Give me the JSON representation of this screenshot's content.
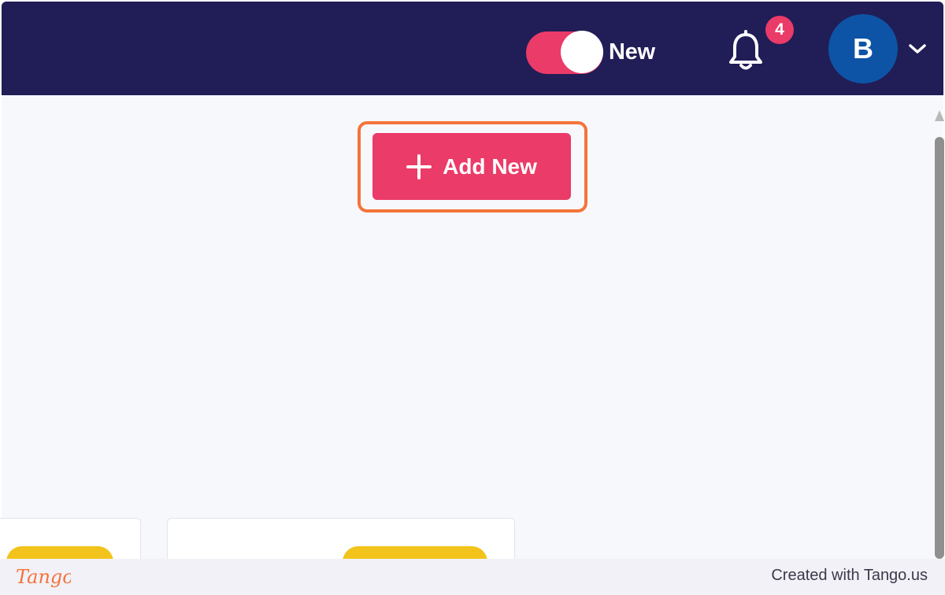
{
  "colors": {
    "navbar": "#211d57",
    "accent": "#eb3b68",
    "toggle_track": "#eb3b68",
    "highlight": "#f4743b",
    "avatar": "#0d54a6",
    "pill": "#f2c31a",
    "footer_text": "#3a3a4a",
    "logo": "#f4743b"
  },
  "header": {
    "toggle_label": "New",
    "toggle_on": true,
    "notification_icon": "bell-icon",
    "notification_count": "4",
    "avatar_initial": "B",
    "menu_icon": "chevron-down-icon"
  },
  "main": {
    "add_button": {
      "icon": "plus-icon",
      "label": "Add New"
    }
  },
  "footer": {
    "logo_text": "Tango",
    "credit": "Created with Tango.us"
  }
}
